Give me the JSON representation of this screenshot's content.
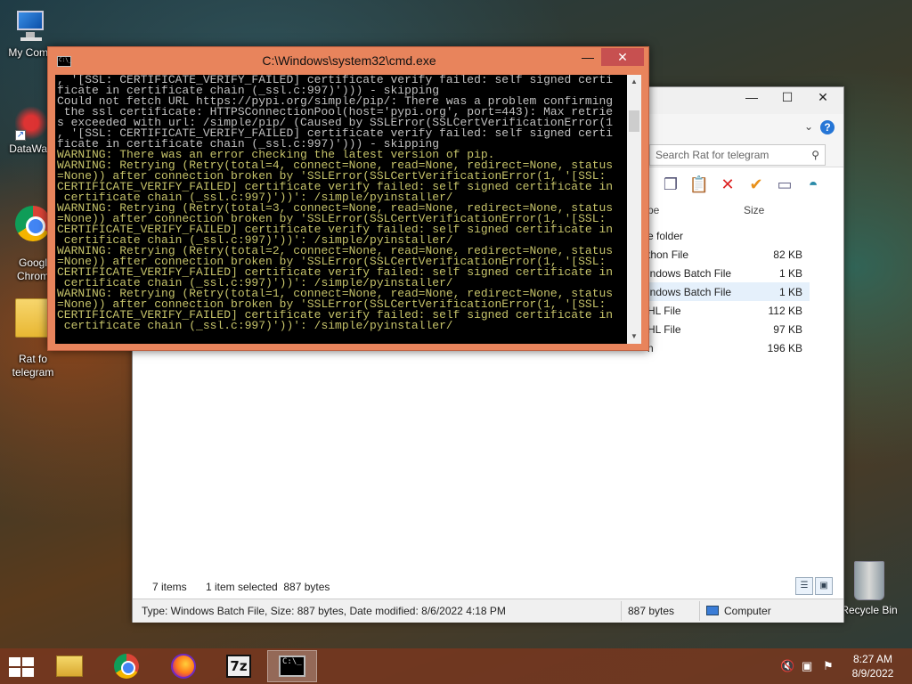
{
  "desktop": {
    "icons": [
      {
        "label": "My Comp"
      },
      {
        "label": "DataWag"
      },
      {
        "label": "Googl\nChrom"
      },
      {
        "label": "Rat fo\ntelegram"
      }
    ],
    "recycle_bin": "Recycle Bin"
  },
  "cmd": {
    "title": "C:\\Windows\\system32\\cmd.exe",
    "icon_text": "C:\\_",
    "minimize": "—",
    "close": "✕",
    "lines": [
      {
        "c": "w",
        "t": ", '[SSL: CERTIFICATE_VERIFY_FAILED] certificate verify failed: self signed certi"
      },
      {
        "c": "w",
        "t": "ficate in certificate chain (_ssl.c:997)'))) - skipping"
      },
      {
        "c": "w",
        "t": "Could not fetch URL https://pypi.org/simple/pip/: There was a problem confirming"
      },
      {
        "c": "w",
        "t": " the ssl certificate: HTTPSConnectionPool(host='pypi.org', port=443): Max retrie"
      },
      {
        "c": "w",
        "t": "s exceeded with url: /simple/pip/ (Caused by SSLError(SSLCertVerificationError(1"
      },
      {
        "c": "w",
        "t": ", '[SSL: CERTIFICATE_VERIFY_FAILED] certificate verify failed: self signed certi"
      },
      {
        "c": "w",
        "t": "ficate in certificate chain (_ssl.c:997)'))) - skipping"
      },
      {
        "c": "y",
        "t": "WARNING: There was an error checking the latest version of pip."
      },
      {
        "c": "y",
        "t": "WARNING: Retrying (Retry(total=4, connect=None, read=None, redirect=None, status"
      },
      {
        "c": "y",
        "t": "=None)) after connection broken by 'SSLError(SSLCertVerificationError(1, '[SSL:"
      },
      {
        "c": "y",
        "t": "CERTIFICATE_VERIFY_FAILED] certificate verify failed: self signed certificate in"
      },
      {
        "c": "y",
        "t": " certificate chain (_ssl.c:997)'))': /simple/pyinstaller/"
      },
      {
        "c": "y",
        "t": "WARNING: Retrying (Retry(total=3, connect=None, read=None, redirect=None, status"
      },
      {
        "c": "y",
        "t": "=None)) after connection broken by 'SSLError(SSLCertVerificationError(1, '[SSL:"
      },
      {
        "c": "y",
        "t": "CERTIFICATE_VERIFY_FAILED] certificate verify failed: self signed certificate in"
      },
      {
        "c": "y",
        "t": " certificate chain (_ssl.c:997)'))': /simple/pyinstaller/"
      },
      {
        "c": "y",
        "t": "WARNING: Retrying (Retry(total=2, connect=None, read=None, redirect=None, status"
      },
      {
        "c": "y",
        "t": "=None)) after connection broken by 'SSLError(SSLCertVerificationError(1, '[SSL:"
      },
      {
        "c": "y",
        "t": "CERTIFICATE_VERIFY_FAILED] certificate verify failed: self signed certificate in"
      },
      {
        "c": "y",
        "t": " certificate chain (_ssl.c:997)'))': /simple/pyinstaller/"
      },
      {
        "c": "y",
        "t": "WARNING: Retrying (Retry(total=1, connect=None, read=None, redirect=None, status"
      },
      {
        "c": "y",
        "t": "=None)) after connection broken by 'SSLError(SSLCertVerificationError(1, '[SSL:"
      },
      {
        "c": "y",
        "t": "CERTIFICATE_VERIFY_FAILED] certificate verify failed: self signed certificate in"
      },
      {
        "c": "y",
        "t": " certificate chain (_ssl.c:997)'))': /simple/pyinstaller/"
      }
    ]
  },
  "explorer": {
    "search_placeholder": "Search Rat for telegram",
    "columns": {
      "type": "pe",
      "size": "Size"
    },
    "files": [
      {
        "type": "e folder",
        "size": "",
        "selected": false
      },
      {
        "type": "thon File",
        "size": "82 KB",
        "selected": false
      },
      {
        "type": "indows Batch File",
        "size": "1 KB",
        "selected": false
      },
      {
        "type": "indows Batch File",
        "size": "1 KB",
        "selected": true
      },
      {
        "type": "HL File",
        "size": "112 KB",
        "selected": false
      },
      {
        "type": "HL File",
        "size": "97 KB",
        "selected": false
      },
      {
        "type": "n",
        "size": "196 KB",
        "selected": false
      }
    ],
    "status": {
      "items": "7 items",
      "selected": "1 item selected  887 bytes"
    },
    "details": {
      "text": "Type: Windows Batch File, Size: 887 bytes, Date modified: 8/6/2022 4:18 PM",
      "size": "887 bytes",
      "location": "Computer"
    }
  },
  "taskbar": {
    "clock_time": "8:27 AM",
    "clock_date": "8/9/2022",
    "items": [
      "file-explorer",
      "chrome",
      "firefox",
      "7-zip",
      "cmd"
    ]
  },
  "colors": {
    "cmd_frame": "#e8845c",
    "cmd_close": "#c75050",
    "cmd_text": "#c0c0c0",
    "cmd_warning": "#c6c36a",
    "taskbar": "#78371e"
  }
}
